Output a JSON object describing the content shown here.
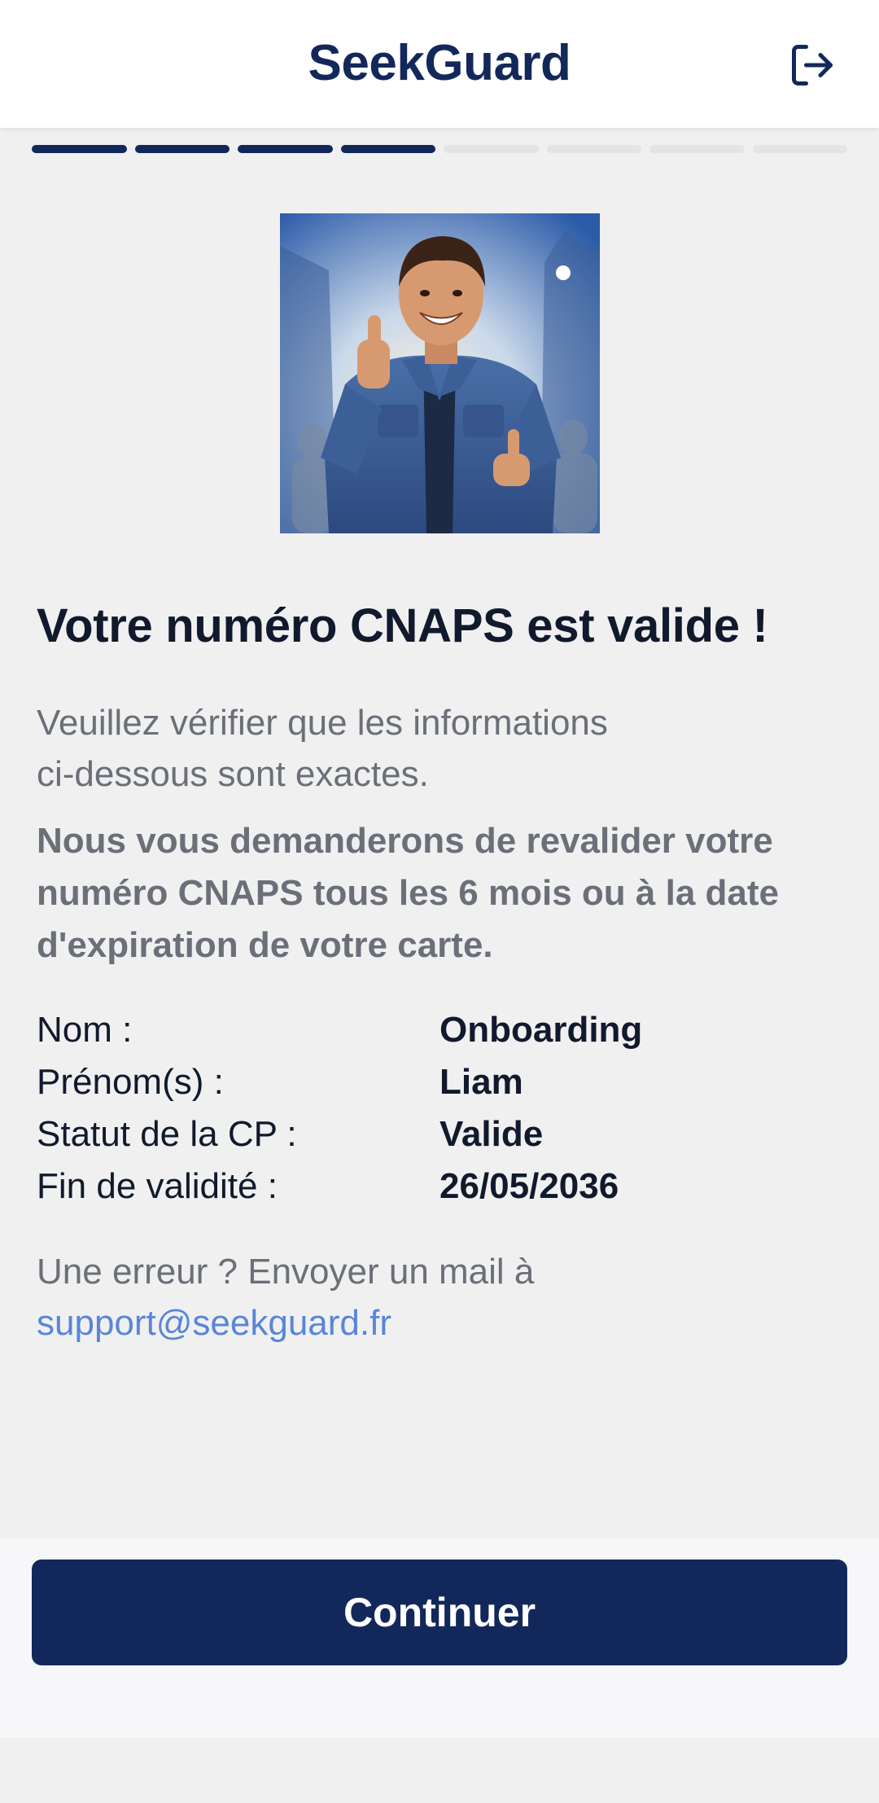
{
  "header": {
    "brand": "SeekGuard",
    "logout_icon": "logout-icon"
  },
  "progress": {
    "total_steps": 8,
    "completed_steps": 4
  },
  "illustration": {
    "icon": "security-guard-thumbs-up-illustration"
  },
  "content": {
    "title": "Votre numéro CNAPS est valide !",
    "subtitle_line1": "Veuillez vérifier que les informations",
    "subtitle_line2": "ci-dessous sont exactes.",
    "notice": "Nous vous demanderons de revalider votre numéro CNAPS tous les 6 mois ou à la date d'expiration de votre carte.",
    "info": [
      {
        "label": "Nom :",
        "value": "Onboarding"
      },
      {
        "label": "Prénom(s) :",
        "value": "Liam"
      },
      {
        "label": "Statut de la CP :",
        "value": "Valide"
      },
      {
        "label": "Fin de validité :",
        "value": "26/05/2036"
      }
    ],
    "error_text": "Une erreur ? Envoyer un mail à",
    "support_email": "support@seekguard.fr"
  },
  "footer": {
    "continue_label": "Continuer"
  },
  "colors": {
    "brand_navy": "#13285a",
    "link_blue": "#5a86d6",
    "muted_text": "#6b6f78",
    "background": "#f0f0f1"
  }
}
